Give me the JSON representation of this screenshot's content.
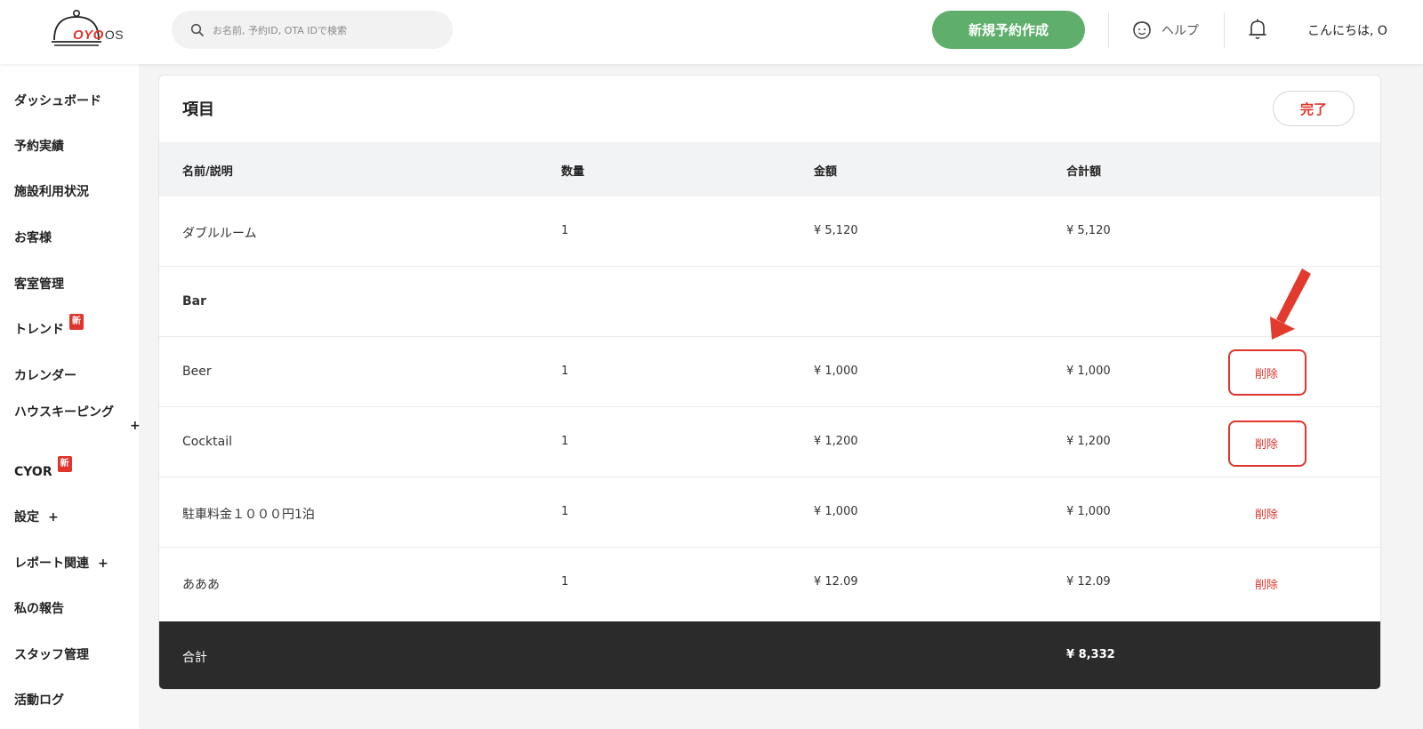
{
  "header": {
    "logo": {
      "brand": "OYO",
      "suffix": "OS"
    },
    "search": {
      "placeholder": "お名前, 予約ID, OTA IDで検索"
    },
    "new_booking_label": "新規予約作成",
    "help_label": "ヘルプ",
    "greeting": "こんにちは, O"
  },
  "sidebar": {
    "items": [
      {
        "label": "ダッシュボード"
      },
      {
        "label": "予約実績"
      },
      {
        "label": "施設利用状況"
      },
      {
        "label": "お客様"
      },
      {
        "label": "客室管理"
      },
      {
        "label": "トレンド",
        "badge": "新"
      },
      {
        "label": "カレンダー"
      },
      {
        "label": "ハウスキーピング",
        "expand": "+"
      },
      {
        "label": "CYOR",
        "badge": "新"
      },
      {
        "label": "設定",
        "expand": "+"
      },
      {
        "label": "レポート関連",
        "expand": "+"
      },
      {
        "label": "私の報告"
      },
      {
        "label": "スタッフ管理"
      },
      {
        "label": "活動ログ"
      }
    ]
  },
  "items_card": {
    "title": "項目",
    "done_label": "完了",
    "columns": [
      "名前/説明",
      "数量",
      "金額",
      "合計額"
    ],
    "rows": [
      {
        "name": "ダブルルーム",
        "qty": "1",
        "amount": "¥ 5,120",
        "total": "¥ 5,120",
        "delete": ""
      },
      {
        "name": "Bar",
        "qty": "",
        "amount": "",
        "total": "",
        "delete": ""
      },
      {
        "name": "Beer",
        "qty": "1",
        "amount": "¥ 1,000",
        "total": "¥ 1,000",
        "delete": "削除"
      },
      {
        "name": "Cocktail",
        "qty": "1",
        "amount": "¥ 1,200",
        "total": "¥ 1,200",
        "delete": "削除"
      },
      {
        "name": "駐車料金１０００円1泊",
        "qty": "1",
        "amount": "¥ 1,000",
        "total": "¥ 1,000",
        "delete": "削除"
      },
      {
        "name": "あああ",
        "qty": "1",
        "amount": "¥ 12.09",
        "total": "¥ 12.09",
        "delete": "削除"
      }
    ],
    "footer": {
      "label": "合計",
      "total": "¥ 8,332"
    }
  },
  "colors": {
    "accent_red": "#e0342c",
    "primary_green": "#5fae6b",
    "footer_dark": "#2b2b2b"
  }
}
